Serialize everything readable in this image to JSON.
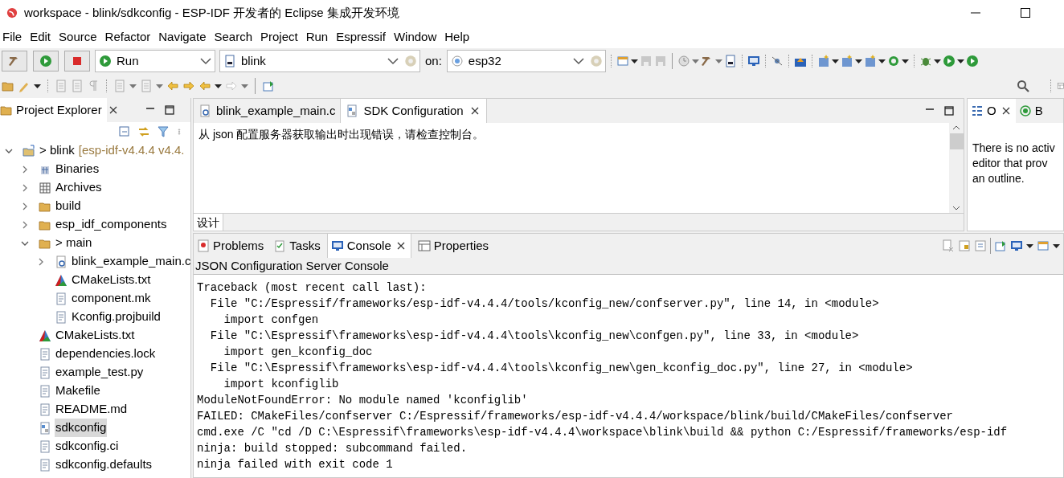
{
  "window": {
    "title": "workspace - blink/sdkconfig - ESP-IDF 开发者的 Eclipse 集成开发环境"
  },
  "menu": [
    "File",
    "Edit",
    "Source",
    "Refactor",
    "Navigate",
    "Search",
    "Project",
    "Run",
    "Espressif",
    "Window",
    "Help"
  ],
  "launch_bar": {
    "mode": "Run",
    "config": "blink",
    "on_label": "on:",
    "target": "esp32"
  },
  "project_explorer": {
    "title": "Project Explorer",
    "items": [
      {
        "label": "> blink",
        "decoration": "[esp-idf-v4.4.4 v4.4.",
        "kind": "project",
        "expanded": true,
        "selected": false,
        "children": [
          {
            "label": "Binaries",
            "kind": "binaries",
            "expanded": false,
            "selected": false
          },
          {
            "label": "Archives",
            "kind": "archives",
            "expanded": false,
            "selected": false
          },
          {
            "label": "build",
            "kind": "folder",
            "expanded": false,
            "selected": false
          },
          {
            "label": "esp_idf_components",
            "kind": "folder",
            "expanded": false,
            "selected": false
          },
          {
            "label": "> main",
            "kind": "folder",
            "expanded": true,
            "selected": false,
            "children": [
              {
                "label": "blink_example_main.c",
                "kind": "csource",
                "expanded": false,
                "selected": false
              },
              {
                "label": "CMakeLists.txt",
                "kind": "cmake",
                "selected": false
              },
              {
                "label": "component.mk",
                "kind": "file",
                "selected": false
              },
              {
                "label": "Kconfig.projbuild",
                "kind": "file",
                "selected": false
              }
            ]
          },
          {
            "label": "CMakeLists.txt",
            "kind": "cmake",
            "selected": false
          },
          {
            "label": "dependencies.lock",
            "kind": "file",
            "selected": false
          },
          {
            "label": "example_test.py",
            "kind": "file",
            "selected": false
          },
          {
            "label": "Makefile",
            "kind": "file",
            "selected": false
          },
          {
            "label": "README.md",
            "kind": "file",
            "selected": false
          },
          {
            "label": "sdkconfig",
            "kind": "config",
            "selected": true
          },
          {
            "label": "sdkconfig.ci",
            "kind": "file",
            "selected": false
          },
          {
            "label": "sdkconfig.defaults",
            "kind": "file",
            "selected": false
          }
        ]
      }
    ]
  },
  "editor": {
    "tabs": [
      {
        "label": "blink_example_main.c",
        "kind": "csource",
        "selected": false
      },
      {
        "label": "SDK Configuration",
        "kind": "config",
        "selected": true
      }
    ],
    "message": "从 json 配置服务器获取输出时出现错误，请检查控制台。",
    "bottom_tab": "设计"
  },
  "outline": {
    "tabs": [
      {
        "label": "O",
        "selected": true
      },
      {
        "label": "B",
        "selected": false
      }
    ],
    "lines": [
      "There is no activ",
      "editor that prov",
      "an outline."
    ]
  },
  "console": {
    "tabs": [
      {
        "label": "Problems",
        "selected": false
      },
      {
        "label": "Tasks",
        "selected": false
      },
      {
        "label": "Console",
        "selected": true
      },
      {
        "label": "Properties",
        "selected": false
      }
    ],
    "title": "JSON Configuration Server Console",
    "lines": [
      "Traceback (most recent call last):",
      "  File \"C:/Espressif/frameworks/esp-idf-v4.4.4/tools/kconfig_new/confserver.py\", line 14, in <module>",
      "    import confgen",
      "  File \"C:\\Espressif\\frameworks\\esp-idf-v4.4.4\\tools\\kconfig_new\\confgen.py\", line 33, in <module>",
      "    import gen_kconfig_doc",
      "  File \"C:\\Espressif\\frameworks\\esp-idf-v4.4.4\\tools\\kconfig_new\\gen_kconfig_doc.py\", line 27, in <module>",
      "    import kconfiglib",
      "ModuleNotFoundError: No module named 'kconfiglib'",
      "FAILED: CMakeFiles/confserver C:/Espressif/frameworks/esp-idf-v4.4.4/workspace/blink/build/CMakeFiles/confserver",
      "cmd.exe /C \"cd /D C:\\Espressif\\frameworks\\esp-idf-v4.4.4\\workspace\\blink\\build && python C:/Espressif/frameworks/esp-idf",
      "ninja: build stopped: subcommand failed.",
      "ninja failed with exit code 1"
    ]
  }
}
